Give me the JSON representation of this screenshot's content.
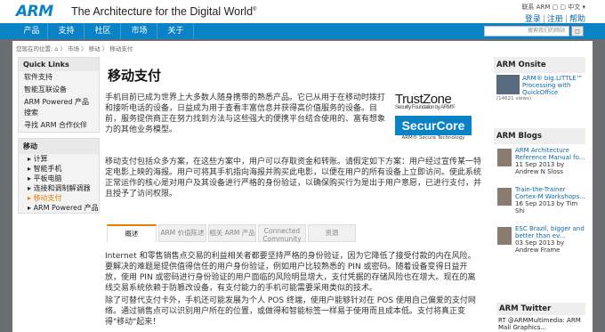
{
  "header": {
    "logo": "ARM",
    "tagline": "The Architecture for the Digital World",
    "tagline_mark": "®",
    "top_right": "联系 ARM ▢ ▢ 中文 ▾",
    "login": "登录",
    "register": "注册",
    "help": "帮助"
  },
  "nav": {
    "items": [
      "产品",
      "支持",
      "社区",
      "市场",
      "关于"
    ],
    "search_placeholder": "搜索我们的网站",
    "search_button": "◻"
  },
  "breadcrumb": "您现在的位置: ⌂ 〉 市场 〉 移动 〉 移动支付",
  "quick_links": {
    "title": "Quick Links",
    "items": [
      "软件支持",
      "智能互联设备",
      "ARM Powered 产品搜索",
      "寻找 ARM 合作伙伴"
    ]
  },
  "mobile": {
    "title": "移动",
    "items": [
      "计算",
      "智能手机",
      "平板电脑",
      "连接和调制解调器",
      "移动支付",
      "ARM Powered 产品"
    ],
    "active": "移动支付"
  },
  "main": {
    "title": "移动支付",
    "p1": "手机目前已成为世界上大多数人随身携带的熟悉产品。它已从用于在移动时拨打和接听电话的设备，日益成为用于查看丰富信息并获得高价值服务的设备。目前，服务提供商正在努力找到方法与这些强大的便携平台结合使用的、富有想象力的其他业务模型。",
    "p2": "移动支付包括众多方案，在这些方案中，用户可以存取资金和转账。请假定如下方案：用户经过宣传某一特定电影上映的海报。用户可将其手机指向海报并购买此电影，以便在用户的所有设备上立即访问。使此系统正常运作的核心是对用户及其设备进行严格的身份验证，以确保购买行为是出于用户意愿，已进行支付，并且授予了访问权限。",
    "p3": "Internet 和零售销售点交易的利益相关者都要坚持严格的身份验证，因为它降低了接受付款的内在风险。要解决的难题是提供值得信任的用户身份验证，例如用户比较熟悉的 PIN 或密码。随着设备变得日益开放，使用 PIN 或密码进行身份验证的用户面临的风险明显增大，支付凭据的存储风险也在增大。现在的离线交易系统依赖于防篡改设备，有支付能力的手机可能需要采用类似的技术。",
    "p4": "除了可替代支付卡外，手机还可能发展为个人 POS 终端，使用户能够针对在 POS 使用自己偏爱的支付网络。通过销售点可以识别用户所在的位置，或做得和智能标签一样易于使用而且成本低。支付将真正变得\"移动\"起来！"
  },
  "logos": {
    "trustzone": "TrustZone",
    "trustzone_sub": "Security Foundation by ARM®",
    "securcore": "SecurCore",
    "securcore_sub": "ARM® Secure Technology"
  },
  "tabs": [
    "概述",
    "ARM 价值陈述",
    "相关 ARM 产品",
    "Connected Community",
    "资源"
  ],
  "right": {
    "onsite_title": "ARM Onsite",
    "onsite_link": "ARM® big.LITTLE™ Processing with QuickOffice",
    "onsite_views": "(14621 views)",
    "blogs_title": "ARM Blogs",
    "blogs": [
      {
        "t": "ARM Architecture Reference Manual fo...",
        "d": "11 Sep 2013 by",
        "a": "Andrew N Sloss"
      },
      {
        "t": "Train-the-Trainer Cortex-M Workshops...",
        "d": "16 Sep 2013 by Tim",
        "a": "Shi"
      },
      {
        "t": "ESC Brazil, bigger and better than ev...",
        "d": "03 Sep 2013 by",
        "a": "Andrew Frame"
      }
    ],
    "twitter_title": "ARM Twitter",
    "tweet": "RT @ARMMultimedia: ARM Mali Graphics..."
  }
}
